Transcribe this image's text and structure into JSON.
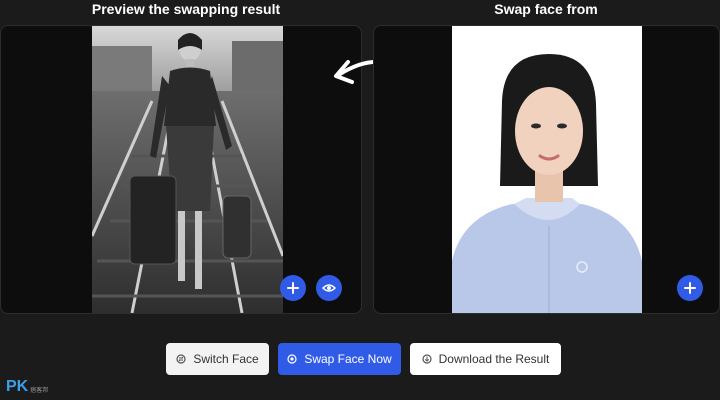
{
  "titles": {
    "result": "Preview the swapping result",
    "source": "Swap face from"
  },
  "buttons": {
    "switch_face": "Switch Face",
    "swap_face_now": "Swap Face Now",
    "download_result": "Download the Result"
  },
  "icons": {
    "add": "plus-icon",
    "preview": "eye-icon",
    "switch": "switch-icon",
    "swap": "face-icon",
    "download": "download-icon",
    "arrow": "curved-arrow-left-icon"
  },
  "colors": {
    "accent": "#2f5be7",
    "background": "#1b1b1c",
    "panel": "#0d0d0e"
  },
  "watermark": {
    "logo": "PK",
    "text": "痞客邦"
  }
}
